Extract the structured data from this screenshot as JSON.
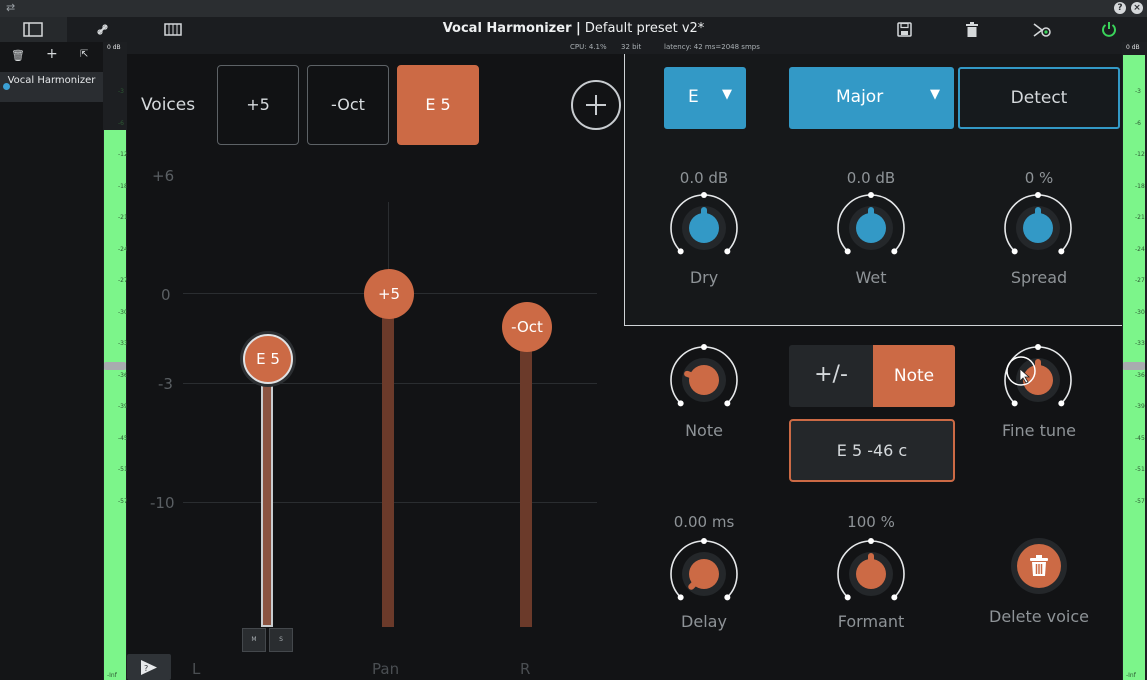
{
  "app": {
    "title_bold": "Vocal Harmonizer |",
    "title_rest": " Default preset v2*"
  },
  "status": {
    "cpu": "CPU: 4.1%",
    "bits": "32 bit",
    "latency": "latency: 42 ms=2048 smps"
  },
  "meters": {
    "left_top": "0 dB",
    "right_top": "0 dB",
    "scale": [
      "-3",
      "-6",
      "-12",
      "-18",
      "-21",
      "-24",
      "-27",
      "-30",
      "-33",
      "-36",
      "-39",
      "-45",
      "-51",
      "-57"
    ],
    "left_bottom": "-Inf",
    "right_bottom": "-Inf"
  },
  "sidebar": {
    "plugin_name": "Vocal Harmonizer"
  },
  "voices": {
    "label": "Voices",
    "buttons": [
      "+5",
      "-Oct",
      "E 5"
    ],
    "active_index": 2
  },
  "faders": {
    "db_labels": [
      "+6",
      "0",
      "-3",
      "-10"
    ],
    "pan_labels": [
      "L",
      "Pan",
      "R"
    ],
    "items": [
      {
        "label": "E 5",
        "db": -2.2,
        "selected": true
      },
      {
        "label": "+5",
        "db": 0,
        "selected": false
      },
      {
        "label": "-Oct",
        "db": -1.1,
        "selected": false
      }
    ],
    "mute_label": "M",
    "solo_label": "S"
  },
  "key": {
    "root": "E",
    "scale": "Major",
    "detect_label": "Detect"
  },
  "mix": {
    "dry": {
      "value": "0.0 dB",
      "name": "Dry"
    },
    "wet": {
      "value": "0.0 dB",
      "name": "Wet"
    },
    "spread": {
      "value": "0 %",
      "name": "Spread"
    }
  },
  "voice_params": {
    "note_name": "Note",
    "pm_label": "+/-",
    "note_mode_label": "Note",
    "note_display": "E 5 -46 c",
    "fine_tune_name": "Fine tune",
    "delay": {
      "value": "0.00 ms",
      "name": "Delay"
    },
    "formant": {
      "value": "100 %",
      "name": "Formant"
    },
    "delete_label": "Delete voice"
  },
  "colors": {
    "accent_orange": "#cc6a45",
    "accent_blue": "#3399c6",
    "meter_green": "#7cf58a",
    "power_green": "#3ad45a"
  }
}
